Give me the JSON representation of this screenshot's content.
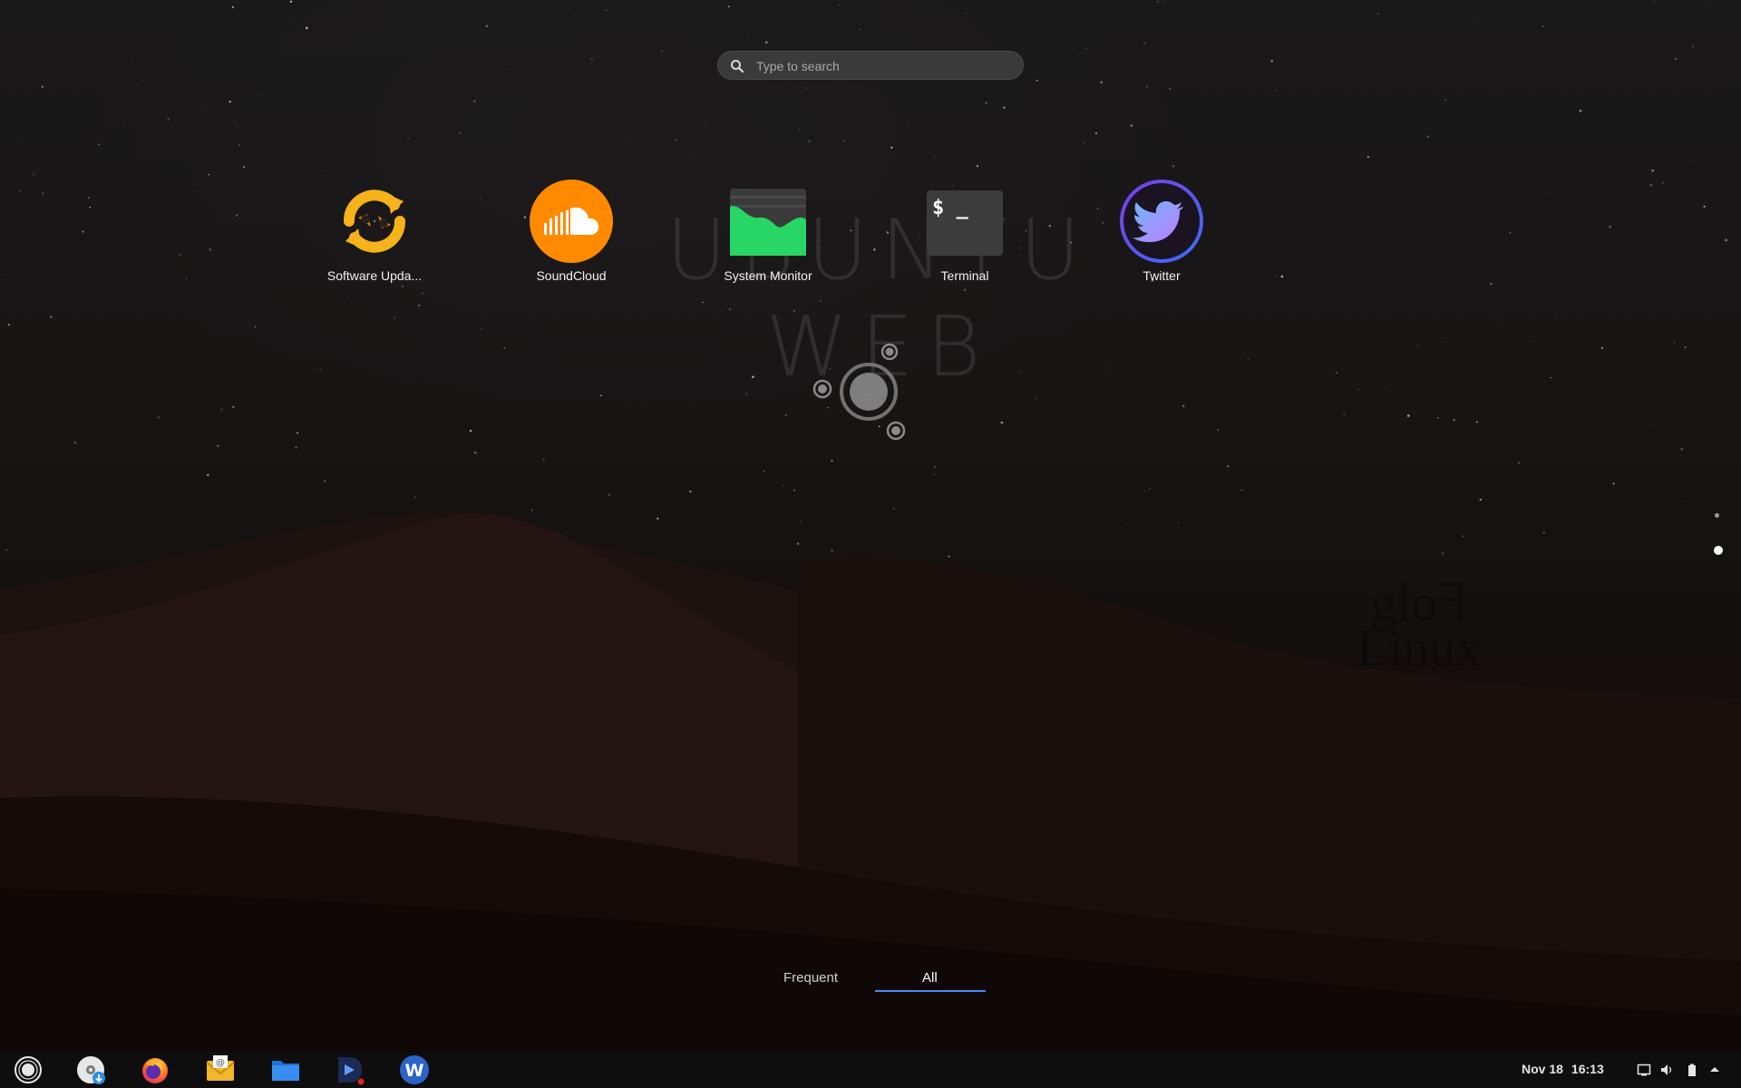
{
  "search": {
    "placeholder": "Type to search"
  },
  "watermark": "UBUNTU WEB",
  "corner_mark": "gloꟻ Linux",
  "apps": [
    {
      "label": "Software Upda...",
      "icon": "software-updater-icon"
    },
    {
      "label": "SoundCloud",
      "icon": "soundcloud-icon"
    },
    {
      "label": "System Monitor",
      "icon": "system-monitor-icon"
    },
    {
      "label": "Terminal",
      "icon": "terminal-icon"
    },
    {
      "label": "Twitter",
      "icon": "twitter-icon"
    }
  ],
  "page_indicator": {
    "pages": 2,
    "current": 2
  },
  "tabs": {
    "frequent": "Frequent",
    "all": "All",
    "active": "All"
  },
  "taskbar": {
    "items": [
      "app-launcher-icon",
      "software-center-icon",
      "firefox-icon",
      "mail-icon",
      "files-icon",
      "video-player-icon",
      "webapps-icon"
    ],
    "date": "Nov 18",
    "time": "16:13",
    "tray": [
      "screen-icon",
      "volume-icon",
      "battery-icon",
      "tray-arrow-icon"
    ]
  },
  "colors": {
    "accent": "#4a8cf7",
    "taskbar": "#0e0e0f"
  }
}
